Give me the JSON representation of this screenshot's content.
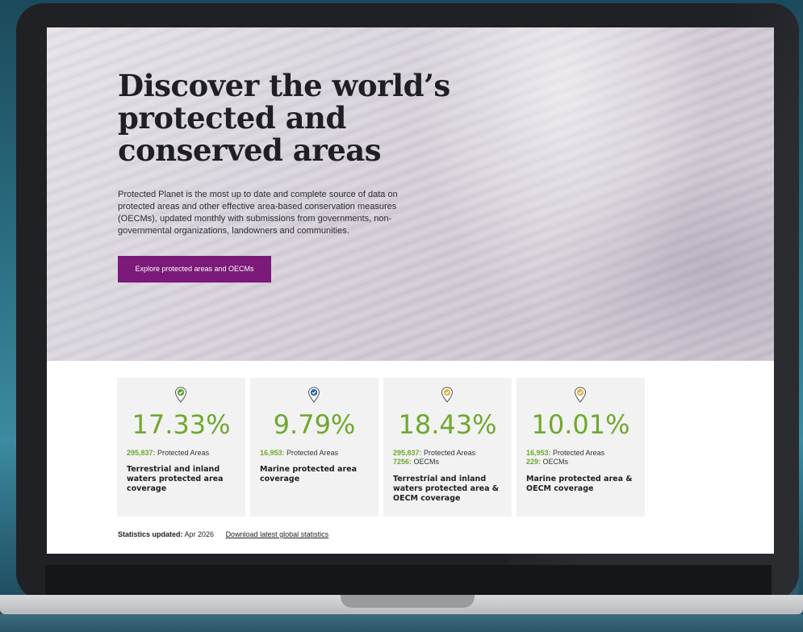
{
  "hero": {
    "title": "Discover the world’s protected and conserved areas",
    "description": "Protected Planet is the most up to date and complete source of data on protected areas and other effective area-based conservation measures (OECMs), updated monthly with submissions from governments, non-governmental organizations, landowners and communities.",
    "cta_label": "Explore protected areas and OECMs"
  },
  "stats": [
    {
      "icon": "map-pin-check-icon",
      "pin_color": "#5aa52a",
      "percent": "17.33%",
      "lines": [
        {
          "number": "295,837:",
          "label": " Protected Areas"
        }
      ],
      "description": "Terrestrial and inland waters protected area coverage"
    },
    {
      "icon": "map-pin-check-icon",
      "pin_color": "#2f67b2",
      "percent": "9.79%",
      "lines": [
        {
          "number": "16,953:",
          "label": " Protected Areas"
        }
      ],
      "description": "Marine protected area coverage"
    },
    {
      "icon": "map-pin-check-icon",
      "pin_color": "#e0b548",
      "percent": "18.43%",
      "lines": [
        {
          "number": "295,837:",
          "label": " Protected Areas"
        },
        {
          "number": "7256:",
          "label": " OECMs"
        }
      ],
      "description": "Terrestrial and inland waters protected area & OECM coverage"
    },
    {
      "icon": "map-pin-check-icon",
      "pin_color": "#e0b548",
      "percent": "10.01%",
      "lines": [
        {
          "number": "16,953:",
          "label": " Protected Areas"
        },
        {
          "number": "229:",
          "label": " OECMs"
        }
      ],
      "description": "Marine protected area & OECM coverage"
    }
  ],
  "footer": {
    "updated_label": "Statistics updated:",
    "updated_value": " Apr 2026",
    "download_link": "Download latest global statistics"
  },
  "colors": {
    "accent_purple": "#7b1a78",
    "stat_green": "#6fa82e"
  }
}
